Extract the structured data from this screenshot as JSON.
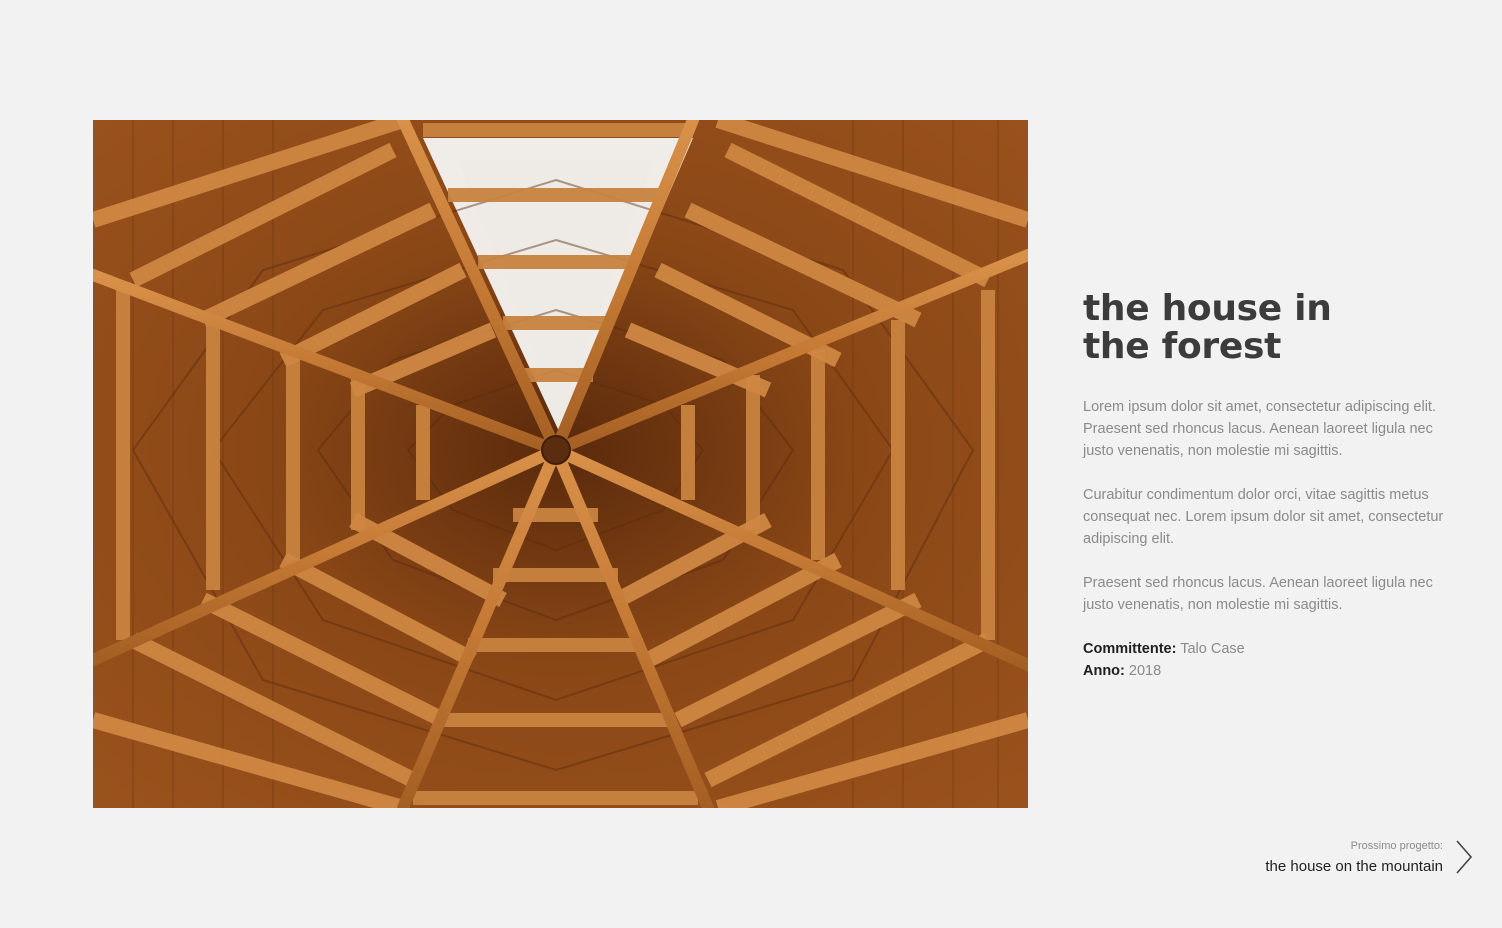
{
  "project": {
    "title": "the house in the forest",
    "paragraphs": [
      "Lorem ipsum dolor sit amet, consectetur adipiscing elit. Praesent sed rhoncus lacus.  Aenean laoreet ligula nec  justo venenatis, non molestie mi sagittis.",
      "Curabitur condimentum dolor orci, vitae sagittis metus consequat nec. Lorem ipsum dolor sit amet, consectetur adipiscing elit.",
      "Praesent sed rhoncus lacus.  Aenean laoreet ligula nec  justo venenatis, non molestie mi sagittis."
    ],
    "client_label": "Committente:",
    "client_value": "Talo Case",
    "year_label": "Anno:",
    "year_value": "2018"
  },
  "next_project": {
    "label": "Prossimo progetto:",
    "title": "the house on the mountain",
    "icon": "chevron-right-icon"
  },
  "colors": {
    "background": "#f2f2f2",
    "heading": "#3c3c3c",
    "body_text": "#8a8a8a",
    "strong_text": "#1f1f1f",
    "wood_dark": "#6b3512",
    "wood_light": "#c8803d"
  }
}
